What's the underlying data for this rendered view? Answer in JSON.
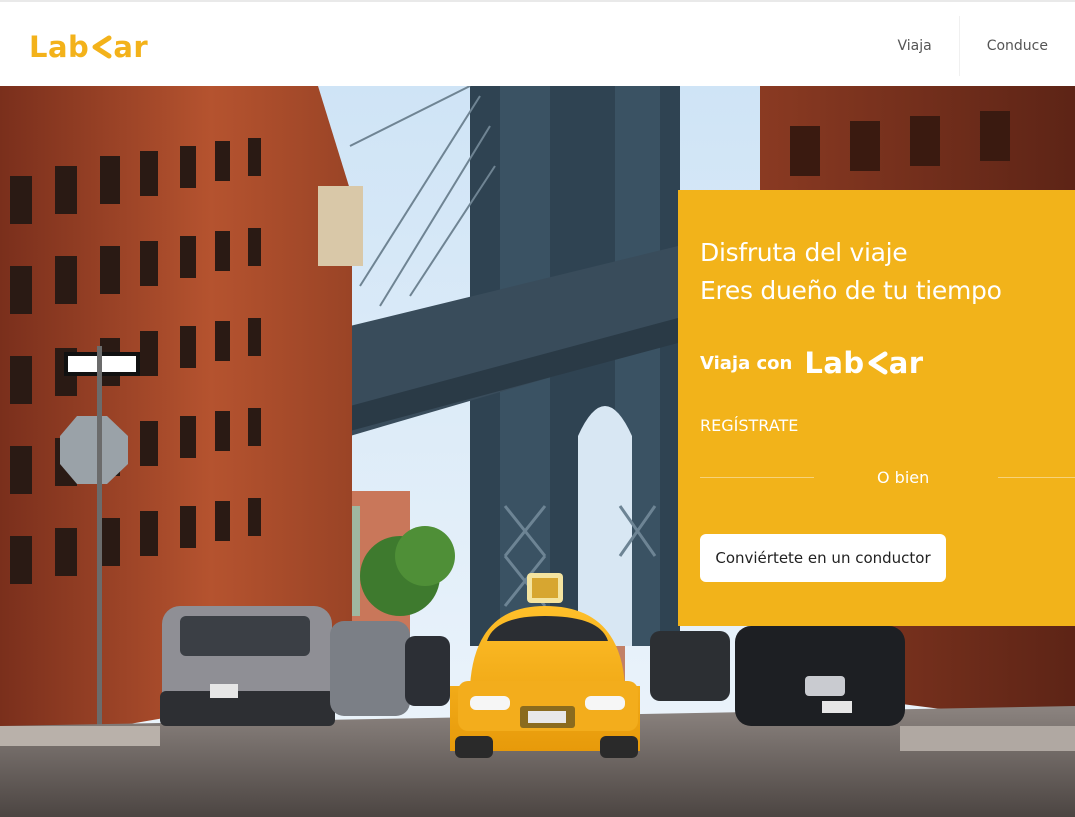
{
  "header": {
    "logo_pre": "Lab",
    "logo_post": "ar",
    "nav": [
      {
        "label": "Viaja"
      },
      {
        "label": "Conduce"
      }
    ]
  },
  "hero": {
    "image_icon": "street-scene-image"
  },
  "promo": {
    "headline_line1": "Disfruta del viaje",
    "headline_line2": "Eres dueño de tu tiempo",
    "ride_with": "Viaja con",
    "brand_pre": "Lab",
    "brand_post": "ar",
    "register": "REGÍSTRATE",
    "or": "O bien",
    "driver_button": "Conviértete en un conductor"
  },
  "colors": {
    "accent": "#f2b31a",
    "logo": "#f3b21a",
    "nav_text": "#555555"
  }
}
